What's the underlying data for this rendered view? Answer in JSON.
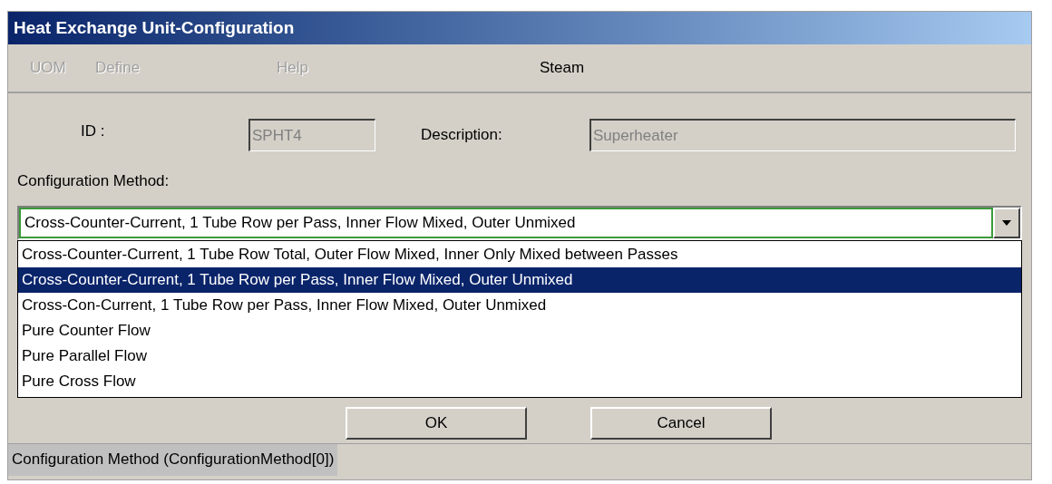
{
  "window": {
    "title": "Heat Exchange Unit-Configuration"
  },
  "menu": [
    {
      "label": "UOM",
      "disabled": true
    },
    {
      "label": "Define",
      "disabled": true
    },
    {
      "label": "Help",
      "disabled": true
    },
    {
      "label": "Steam",
      "disabled": false
    }
  ],
  "id_field": {
    "label": "ID :",
    "value": "SPHT4",
    "disabled": true
  },
  "description_field": {
    "label": "Description:",
    "value": "Superheater",
    "disabled": true
  },
  "configuration_method": {
    "label": "Configuration Method:",
    "value": "Cross-Counter-Current, 1 Tube Row per Pass, Inner Flow Mixed, Outer Unmixed",
    "expanded": true,
    "options": [
      {
        "label": "Cross-Counter-Current, 1 Tube Row Total, Outer Flow Mixed, Inner Only Mixed between Passes",
        "selected": false
      },
      {
        "label": "Cross-Counter-Current, 1 Tube Row per Pass, Inner Flow Mixed, Outer Unmixed",
        "selected": true
      },
      {
        "label": "Cross-Con-Current, 1 Tube Row per Pass, Inner Flow Mixed, Outer Unmixed",
        "selected": false
      },
      {
        "label": "Pure Counter Flow",
        "selected": false
      },
      {
        "label": "Pure Parallel Flow",
        "selected": false
      },
      {
        "label": "Pure Cross Flow",
        "selected": false
      }
    ]
  },
  "buttons": [
    "OK",
    "Cancel"
  ],
  "status_bar": "Configuration Method (ConfigurationMethod[0])"
}
